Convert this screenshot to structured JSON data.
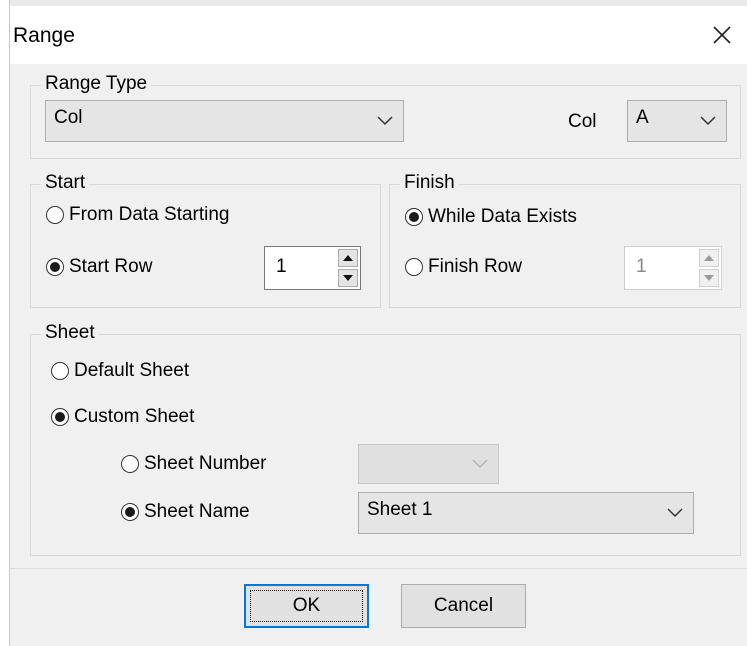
{
  "window": {
    "title": "Range"
  },
  "range_type": {
    "legend": "Range Type",
    "selected": "Col",
    "col_label": "Col",
    "col_selected": "A"
  },
  "start": {
    "legend": "Start",
    "from_data_label": "From Data Starting",
    "from_data_selected": false,
    "start_row_label": "Start Row",
    "start_row_selected": true,
    "start_row_value": "1"
  },
  "finish": {
    "legend": "Finish",
    "while_exists_label": "While Data Exists",
    "while_exists_selected": true,
    "finish_row_label": "Finish Row",
    "finish_row_selected": false,
    "finish_row_value": "1"
  },
  "sheet": {
    "legend": "Sheet",
    "default_label": "Default Sheet",
    "default_selected": false,
    "custom_label": "Custom Sheet",
    "custom_selected": true,
    "number_label": "Sheet Number",
    "number_selected": false,
    "number_value": "",
    "name_label": "Sheet Name",
    "name_selected": true,
    "name_value": "Sheet 1"
  },
  "buttons": {
    "ok": "OK",
    "cancel": "Cancel"
  },
  "colors": {
    "accent": "#0078d7",
    "dialog_bg": "#f0f0f0"
  },
  "icons": {
    "close": "close-icon",
    "dropdown": "chevron-down-icon",
    "spin_up": "triangle-up-icon",
    "spin_down": "triangle-down-icon"
  }
}
